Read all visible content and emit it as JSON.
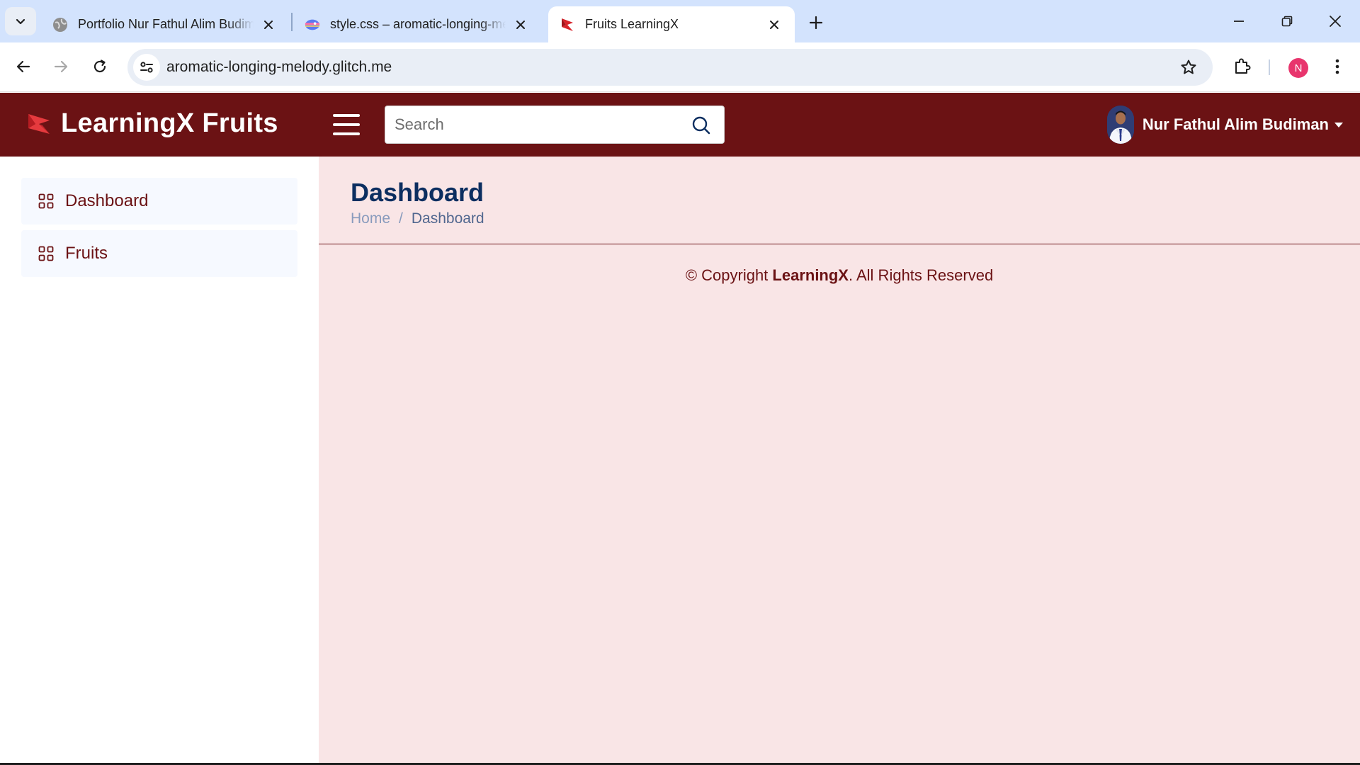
{
  "browser": {
    "tabs": [
      {
        "title": "Portfolio Nur Fathul Alim Budiman",
        "icon": "globe-icon",
        "active": false
      },
      {
        "title": "style.css – aromatic-longing-melody",
        "icon": "glitch-fish-icon",
        "active": false
      },
      {
        "title": "Fruits LearningX",
        "icon": "learningx-logo-icon",
        "active": true
      }
    ],
    "url": "aromatic-longing-melody.glitch.me",
    "profile_initial": "N"
  },
  "header": {
    "brand": "LearningX Fruits",
    "search_placeholder": "Search",
    "user_name": "Nur Fathul Alim Budiman"
  },
  "sidebar": {
    "items": [
      {
        "label": "Dashboard",
        "icon": "grid-icon"
      },
      {
        "label": "Fruits",
        "icon": "grid-icon"
      }
    ]
  },
  "main": {
    "title": "Dashboard",
    "breadcrumb": {
      "home": "Home",
      "separator": "/",
      "current": "Dashboard"
    }
  },
  "footer": {
    "prefix": "© Copyright ",
    "brand": "LearningX",
    "suffix": ". All Rights Reserved"
  },
  "colors": {
    "header_bg": "#6b1214",
    "main_bg": "#f9e5e6",
    "title": "#0c2e60",
    "tabstrip_bg": "#d3e3fd"
  }
}
